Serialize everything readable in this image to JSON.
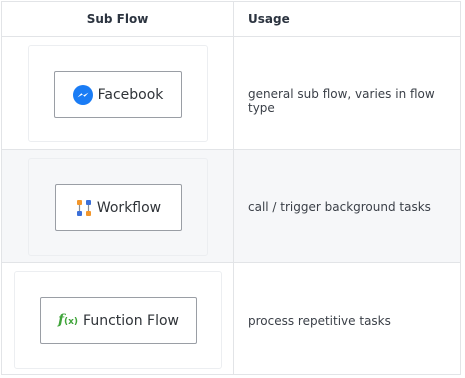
{
  "table": {
    "headers": {
      "sub_flow": "Sub Flow",
      "usage": "Usage"
    },
    "rows": [
      {
        "button_label": "Facebook",
        "icon": "messenger-icon",
        "usage": "general sub flow, varies in flow type"
      },
      {
        "button_label": "Workflow",
        "icon": "workflow-icon",
        "usage": "call / trigger background tasks"
      },
      {
        "button_label": "Function Flow",
        "icon": "function-fx-icon",
        "icon_text": "f",
        "icon_text_suffix": "(x)",
        "usage": "process repetitive tasks"
      }
    ]
  },
  "colors": {
    "messenger_blue": "#1a7cf5",
    "function_green": "#3fa43a",
    "workflow_orange": "#f2962b",
    "workflow_blue": "#3b6fd8",
    "alt_row_bg": "#f6f7f9",
    "border": "#e2e4e7"
  }
}
